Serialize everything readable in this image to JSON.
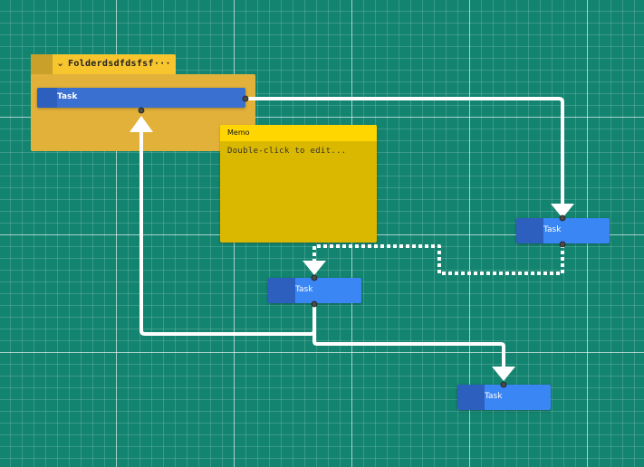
{
  "folder": {
    "name": "Folderdsdfdsfsf",
    "overflow": "···",
    "collapse_icon": "chevron-down-icon"
  },
  "memo": {
    "title": "Memo",
    "placeholder": "Double-click to edit..."
  },
  "tasks": [
    {
      "label": "Task"
    },
    {
      "label": "Task"
    },
    {
      "label": "Task"
    },
    {
      "label": "Task"
    }
  ],
  "colors": {
    "canvas": "#138470",
    "folder": "#e2b13a",
    "folder_tab": "#f7c52e",
    "memo": "#dbb800",
    "memo_header": "#ffd600",
    "task": "#3b86f5",
    "task_handle": "#2d5fbf",
    "connector": "#ffffff"
  }
}
